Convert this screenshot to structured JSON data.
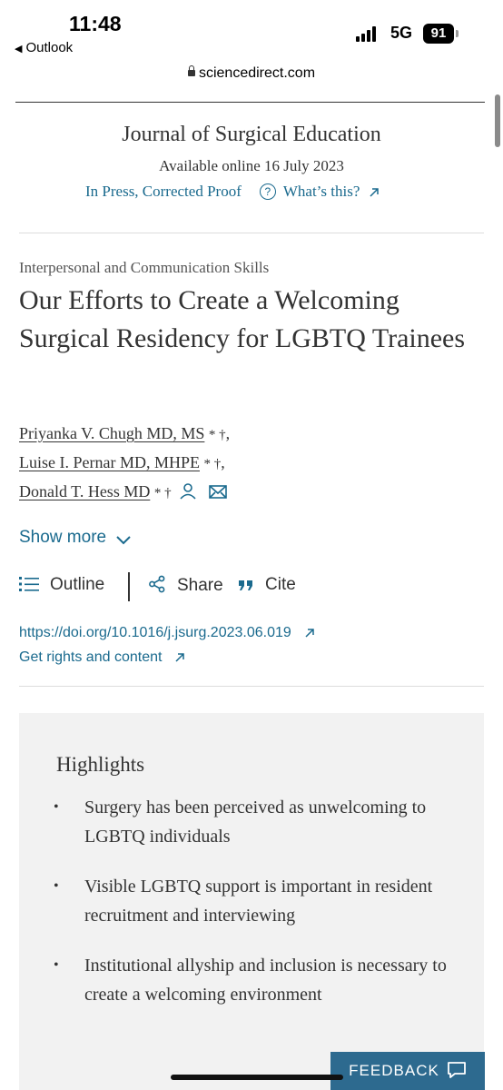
{
  "status_bar": {
    "time": "11:48",
    "back_app": "Outlook",
    "network": "5G",
    "battery": "91"
  },
  "browser": {
    "url": "sciencedirect.com"
  },
  "journal": {
    "title": "Journal of Surgical Education",
    "available_online": "Available online 16 July 2023",
    "status": "In Press, Corrected Proof",
    "whats_this": "What’s this?"
  },
  "article": {
    "type": "Interpersonal and Communication Skills",
    "title": "Our Efforts to Create a Welcoming Surgical Residency for LGBTQ Trainees",
    "authors": [
      {
        "name": "Priyanka V. Chugh MD, MS",
        "marks": "* †",
        "sep": ","
      },
      {
        "name": "Luise I. Pernar MD, MHPE",
        "marks": "* †",
        "sep": ","
      },
      {
        "name": "Donald T. Hess MD",
        "marks": "* †",
        "sep": ""
      }
    ],
    "show_more": "Show more",
    "tools": {
      "outline": "Outline",
      "share": "Share",
      "cite": "Cite"
    },
    "doi": "https://doi.org/10.1016/j.jsurg.2023.06.019",
    "rights": "Get rights and content"
  },
  "highlights": {
    "heading": "Highlights",
    "items": [
      "Surgery has been perceived as unwelcoming to LGBTQ individuals",
      "Visible LGBTQ support is important in resident recruitment and interviewing",
      "Institutional allyship and inclusion is necessary to create a welcoming environment"
    ]
  },
  "feedback": {
    "label": "FEEDBACK"
  },
  "colors": {
    "link": "#1a6a8e",
    "feedback_bg": "#2d6a8f",
    "highlights_bg": "#f2f2f2"
  }
}
